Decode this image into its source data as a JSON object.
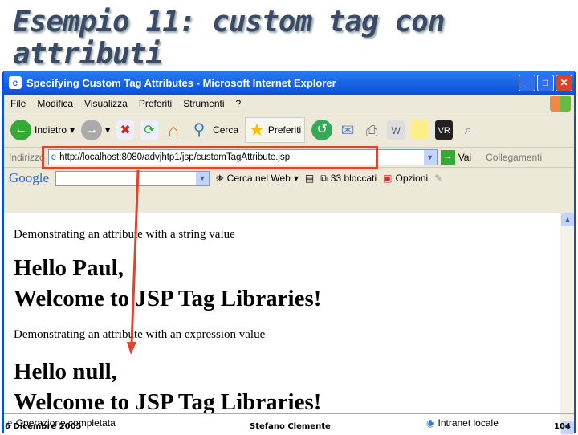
{
  "slide": {
    "title": "Esempio 11: custom tag con attributi",
    "footer_date": "6 Dicembre 2005",
    "footer_author": "Stefano Clemente",
    "page_number": "104"
  },
  "window": {
    "title": "Specifying Custom Tag Attributes - Microsoft Internet Explorer"
  },
  "menu": [
    "File",
    "Modifica",
    "Visualizza",
    "Preferiti",
    "Strumenti",
    "?"
  ],
  "toolbar": {
    "back": "Indietro",
    "search": "Cerca",
    "favorites": "Preferiti"
  },
  "address": {
    "label": "Indirizzo",
    "url": "http://localhost:8080/advjhtp1/jsp/customTagAttribute.jsp",
    "go": "Vai",
    "links": "Collegamenti"
  },
  "google": {
    "logo": "Google",
    "search_web": "Cerca nel Web",
    "blocked": "33 bloccati",
    "options": "Opzioni"
  },
  "content": {
    "line1": "Demonstrating an attribute with a string value",
    "hello1": "Hello Paul,",
    "welcome1": "Welcome to JSP Tag Libraries!",
    "line2": "Demonstrating an attribute with an expression value",
    "hello2": "Hello null,",
    "welcome2": "Welcome to JSP Tag Libraries!"
  },
  "status": {
    "text": "Operazione completata",
    "zone": "Intranet locale"
  },
  "colors": {
    "highlight": "#e0442a",
    "titlebar": "#0a4fd8"
  }
}
